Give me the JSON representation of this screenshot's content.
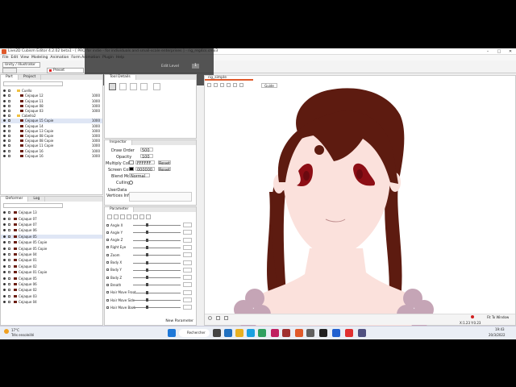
{
  "window": {
    "title": "Live2D Cubism Editor 4.2.02 beta1 - [ PRO for indie - for individuals and small-scale enterprises ] - rig_reg4cs.cmo3"
  },
  "menu": [
    "File",
    "Edit",
    "View",
    "Modeling",
    "Animation",
    "Form Animation",
    "Plugin",
    "Help"
  ],
  "toolbar": {
    "workspace": "Unity / Illustrator",
    "preset": "Preset",
    "edit_level_label": "Edit Level",
    "edit_level_value": "1"
  },
  "left_top_panel": {
    "tabs": [
      "Part",
      "Project"
    ],
    "rows": [
      {
        "label": "Cuello",
        "value": "",
        "indent": 1
      },
      {
        "label": "Cejaque 12",
        "value": "1000",
        "indent": 2
      },
      {
        "label": "Cejaque 11",
        "value": "1000",
        "indent": 2
      },
      {
        "label": "Cejaque 08",
        "value": "1000",
        "indent": 2
      },
      {
        "label": "Cejaque 03",
        "value": "1000",
        "indent": 2
      },
      {
        "label": "Cabello2",
        "value": "",
        "indent": 1
      },
      {
        "label": "Cejaque 15 Copie",
        "value": "1000",
        "indent": 2
      },
      {
        "label": "Cejaque 14",
        "value": "1000",
        "indent": 2
      },
      {
        "label": "Cejaque 13 Copie",
        "value": "1000",
        "indent": 2
      },
      {
        "label": "Cejaque 08 Copie",
        "value": "1000",
        "indent": 2
      },
      {
        "label": "Cejaque 08 Copie",
        "value": "1000",
        "indent": 2
      },
      {
        "label": "Cejaque 11 Copie",
        "value": "1000",
        "indent": 2
      },
      {
        "label": "Cejaque 16",
        "value": "1000",
        "indent": 2
      },
      {
        "label": "Cejaque 16",
        "value": "1000",
        "indent": 2
      }
    ]
  },
  "tool_details": {
    "tab": "Tool Details"
  },
  "inspector": {
    "tab": "Inspector",
    "draw_order_label": "Draw Order",
    "draw_order_value": "500",
    "opacity_label": "Opacity",
    "opacity_value": "100",
    "multiply_label": "Multiply Color",
    "multiply_value": "FFFFFF",
    "screen_label": "Screen Color",
    "screen_value": "000000",
    "reset_label": "Reset",
    "blend_label": "Blend Mode",
    "blend_value": "Normal",
    "culling_label": "Culling",
    "user_data_label": "UserData",
    "vertices_label": "Vertices Info"
  },
  "left_bottom_panel": {
    "tabs": [
      "Deformer",
      "Log"
    ],
    "rows": [
      "Cejaque 13",
      "Cejaque 07",
      "Cejaque 07",
      "Cejaque 06",
      "Cejaque 05",
      "Cejaque 05 Copie",
      "Cejaque 05 Copie",
      "Cejaque 04",
      "Cejaque 01",
      "Cejaque 02",
      "Cejaque 01 Copie",
      "Cejaque 05",
      "Cejaque 06",
      "Cejaque 02",
      "Cejaque 03",
      "Cejaque 04"
    ]
  },
  "parameters": {
    "tab": "Parameter",
    "rows": [
      "Angle X",
      "Angle Y",
      "Angle Z",
      "Right Eye",
      "Zoom",
      "Body X",
      "Body Y",
      "Body Z",
      "Breath",
      "Hair Move Front",
      "Hair Move Side",
      "Hair Move Back"
    ],
    "new_param": "New Parameter"
  },
  "canvas": {
    "tab": "rig_simple",
    "view_label": "Guide",
    "zoom": "Fit To Window",
    "coords": "X:1.23  Y:0.23"
  },
  "taskbar": {
    "weather_temp": "17°C",
    "weather_text": "Très ensoleillé",
    "search": "Rechercher",
    "time": "19:43",
    "date": "20/3/2022"
  },
  "colors": {
    "hair": "#5d1b10",
    "skin": "#fbe1dc",
    "eyes": "#8d0e15",
    "dress": "#c5a5b6",
    "accent": "#e05a2b"
  }
}
